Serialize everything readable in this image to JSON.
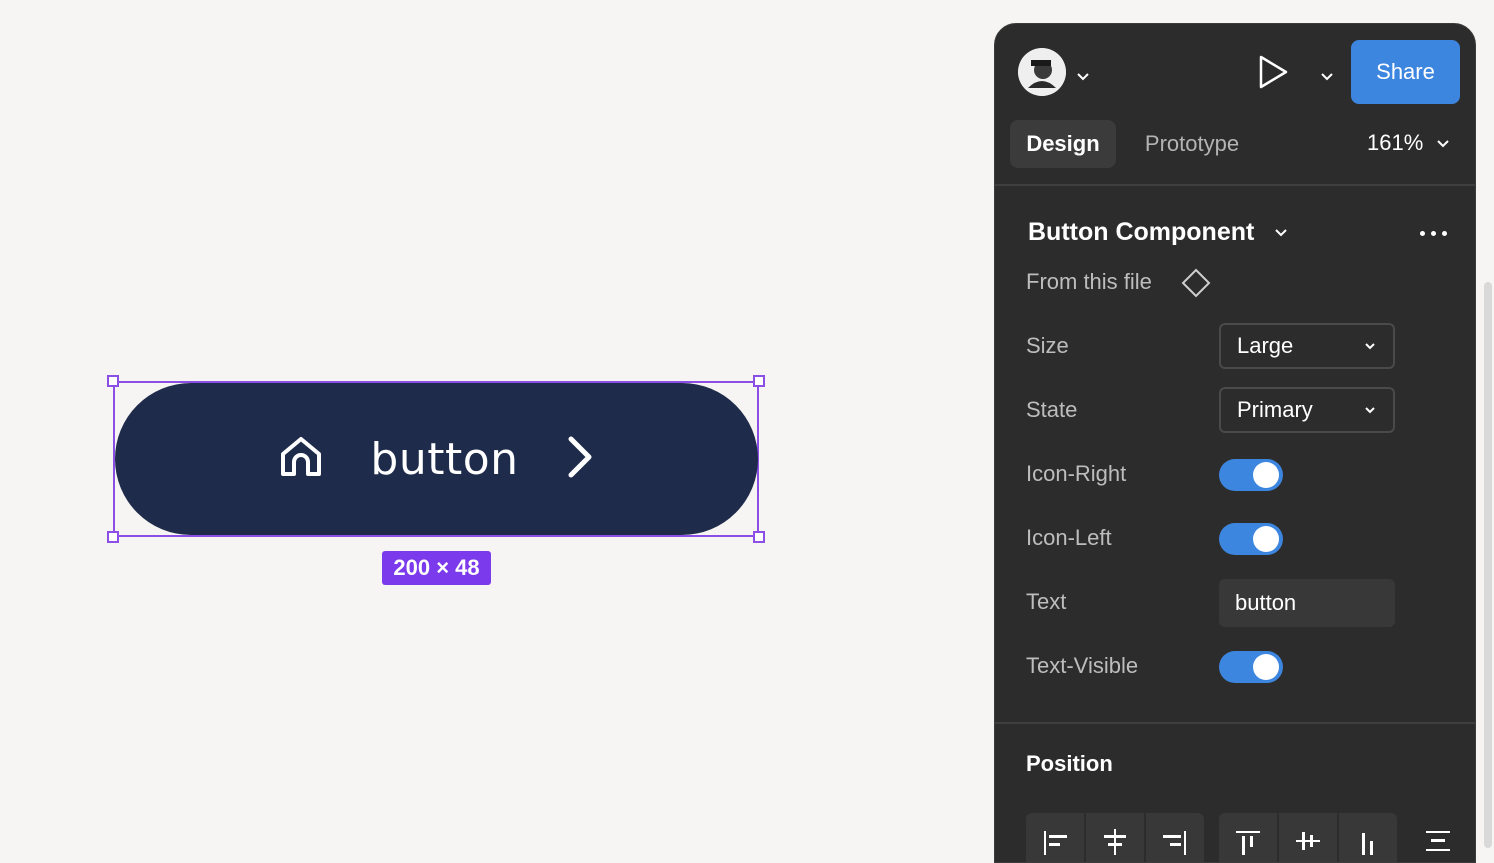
{
  "canvas": {
    "component_text": "button",
    "size_badge": "200 × 48",
    "icons": [
      "home-icon",
      "chevron-right-icon"
    ],
    "colors": {
      "button_fill": "#1e2b4b",
      "selection": "#8b4fe6",
      "badge": "#7c3aed"
    }
  },
  "header": {
    "share_label": "Share",
    "icons": [
      "avatar",
      "play-icon",
      "chevron-down-icon"
    ]
  },
  "tabs": [
    {
      "label": "Design",
      "active": true
    },
    {
      "label": "Prototype",
      "active": false
    }
  ],
  "zoom": "161%",
  "component": {
    "title": "Button Component",
    "source": "From this file",
    "properties": {
      "size": {
        "label": "Size",
        "value": "Large"
      },
      "state": {
        "label": "State",
        "value": "Primary"
      },
      "icon_right": {
        "label": "Icon-Right",
        "on": true
      },
      "icon_left": {
        "label": "Icon-Left",
        "on": true
      },
      "text": {
        "label": "Text",
        "value": "button"
      },
      "text_visible": {
        "label": "Text-Visible",
        "on": true
      }
    }
  },
  "position": {
    "title": "Position",
    "align_icons": [
      "align-left-icon",
      "align-horizontal-center-icon",
      "align-right-icon",
      "align-top-icon",
      "align-vertical-center-icon",
      "align-bottom-icon",
      "distribute-icon"
    ]
  },
  "colors": {
    "accent": "#3d86e0",
    "panel_bg": "#2c2c2c"
  }
}
